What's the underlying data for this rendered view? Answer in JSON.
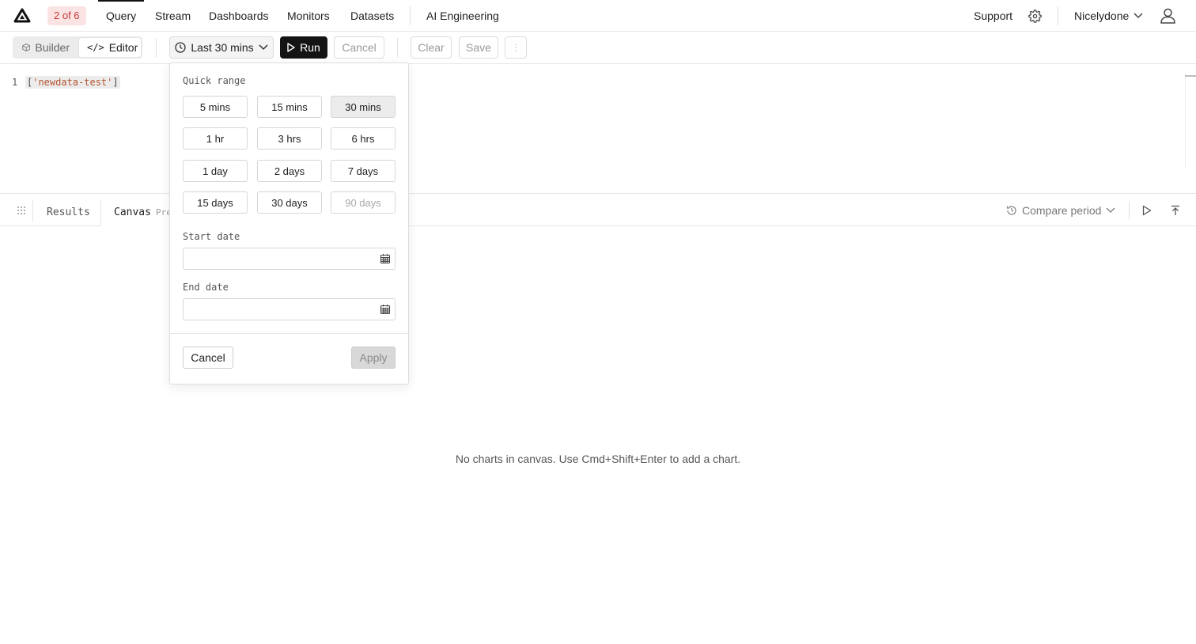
{
  "nav": {
    "badge": "2 of 6",
    "tabs": [
      {
        "label": "Query",
        "active": true
      },
      {
        "label": "Stream"
      },
      {
        "label": "Dashboards"
      },
      {
        "label": "Monitors"
      },
      {
        "label": "Datasets"
      },
      {
        "label": "AI Engineering"
      }
    ],
    "support": "Support",
    "org": "Nicelydone"
  },
  "toolbar": {
    "builder": "Builder",
    "editor": "Editor",
    "time_range": "Last 30 mins",
    "run": "Run",
    "cancel": "Cancel",
    "clear": "Clear",
    "save": "Save"
  },
  "editor": {
    "line_number": "1",
    "code_open": "[",
    "code_string": "'newdata-test'",
    "code_close": "]"
  },
  "results_bar": {
    "tab_results": "Results",
    "tab_canvas": "Canvas",
    "canvas_badge": "Preview",
    "compare": "Compare period"
  },
  "canvas": {
    "empty_message": "No charts in canvas. Use Cmd+Shift+Enter to add a chart."
  },
  "popover": {
    "quick_range_label": "Quick range",
    "quick_ranges": [
      {
        "label": "5 mins"
      },
      {
        "label": "15 mins"
      },
      {
        "label": "30 mins",
        "selected": true
      },
      {
        "label": "1 hr"
      },
      {
        "label": "3 hrs"
      },
      {
        "label": "6 hrs"
      },
      {
        "label": "1 day"
      },
      {
        "label": "2 days"
      },
      {
        "label": "7 days"
      },
      {
        "label": "15 days"
      },
      {
        "label": "30 days"
      },
      {
        "label": "90 days",
        "disabled": true
      }
    ],
    "start_label": "Start date",
    "start_value": "",
    "end_label": "End date",
    "end_value": "",
    "cancel": "Cancel",
    "apply": "Apply"
  }
}
